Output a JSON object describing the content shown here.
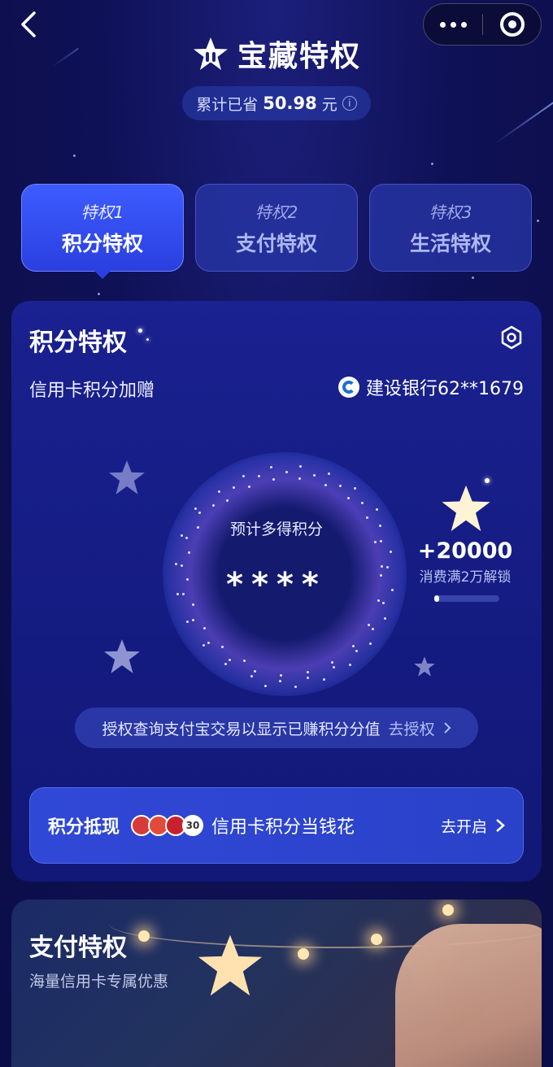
{
  "header": {
    "title": "宝藏特权",
    "savings_prefix": "累计已省",
    "savings_amount": "50.98",
    "savings_unit": "元",
    "info_glyph": "i"
  },
  "tabs": [
    {
      "small": "特权1",
      "big": "积分特权",
      "active": true
    },
    {
      "small": "特权2",
      "big": "支付特权",
      "active": false
    },
    {
      "small": "特权3",
      "big": "生活特权",
      "active": false
    }
  ],
  "points_card": {
    "title": "积分特权",
    "subtitle": "信用卡积分加赠",
    "bank": "建设银行62**1679",
    "estimate_label": "预计多得积分",
    "estimate_value": "****",
    "bonus_points": "+20000",
    "bonus_condition": "消费满2万解锁",
    "bonus_progress": 0.06,
    "auth_text": "授权查询支付宝交易以显示已赚积分分值",
    "auth_link": "去授权",
    "exchange": {
      "label": "积分抵现",
      "chip_count": "30",
      "desc": "信用卡积分当钱花",
      "go": "去开启"
    }
  },
  "payment_card": {
    "title": "支付特权",
    "subtitle": "海量信用卡专属优惠"
  },
  "colors": {
    "bg": "#0d0f4a",
    "accent": "#3d5cff",
    "card": "#1a2190"
  },
  "icons": [
    "back-icon",
    "more-icon",
    "close-icon",
    "star-logo-icon",
    "info-icon",
    "gear-icon",
    "bank-logo-icon",
    "chevron-right-icon"
  ]
}
